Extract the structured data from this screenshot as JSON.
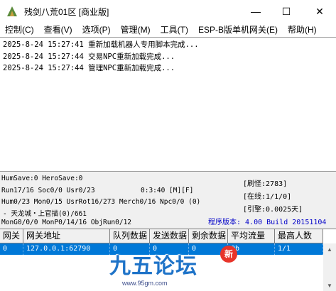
{
  "window": {
    "title": "残剑八荒01区 [商业版]",
    "min_glyph": "—",
    "max_glyph": "☐",
    "close_glyph": "✕"
  },
  "menu": [
    "控制(C)",
    "查看(V)",
    "选项(P)",
    "管理(M)",
    "工具(T)",
    "ESP-B版单机网关(E)",
    "帮助(H)"
  ],
  "log": [
    "2025-8-24 15:27:41 重新加载机器人专用脚本完成...",
    "2025-8-24 15:27:44 交易NPC重新加载完成...",
    "2025-8-24 15:27:44 管理NPC重新加载完成..."
  ],
  "status": {
    "save": "HumSave:0 HeroSave:0",
    "run": "Run17/16 Soc0/0 Usr0/23",
    "time": "0:3:40 [M][F]",
    "hum": "Hum0/23 Mon0/15 UsrRot16/273 Merch0/16 Npc0/0 (0)",
    "map": "- 天龙城・上官描(0)/661",
    "mon": "MonG0/0/0 MonP0/14/16 ObjRun0/12",
    "refresh": "[刷怪:2783]",
    "online": "[在线:1/1/0]",
    "engine": "[引擎:0.0025天]",
    "version": "程序版本: 4.00 Build 20151104"
  },
  "table": {
    "headers": [
      "网关",
      "网关地址",
      "队列数据",
      "发送数据",
      "剩余数据",
      "平均流量",
      "最高人数"
    ],
    "rows": [
      [
        "0",
        "127.0.0.1:62790",
        "0",
        "0",
        "0",
        "0b",
        "1/1"
      ]
    ]
  },
  "watermark": {
    "title": "九五论坛",
    "badge": "新",
    "url": "www.95gm.com"
  },
  "colors": {
    "selection": "#0078d7",
    "version_text": "#0000c8",
    "watermark": "#1e73c8"
  }
}
